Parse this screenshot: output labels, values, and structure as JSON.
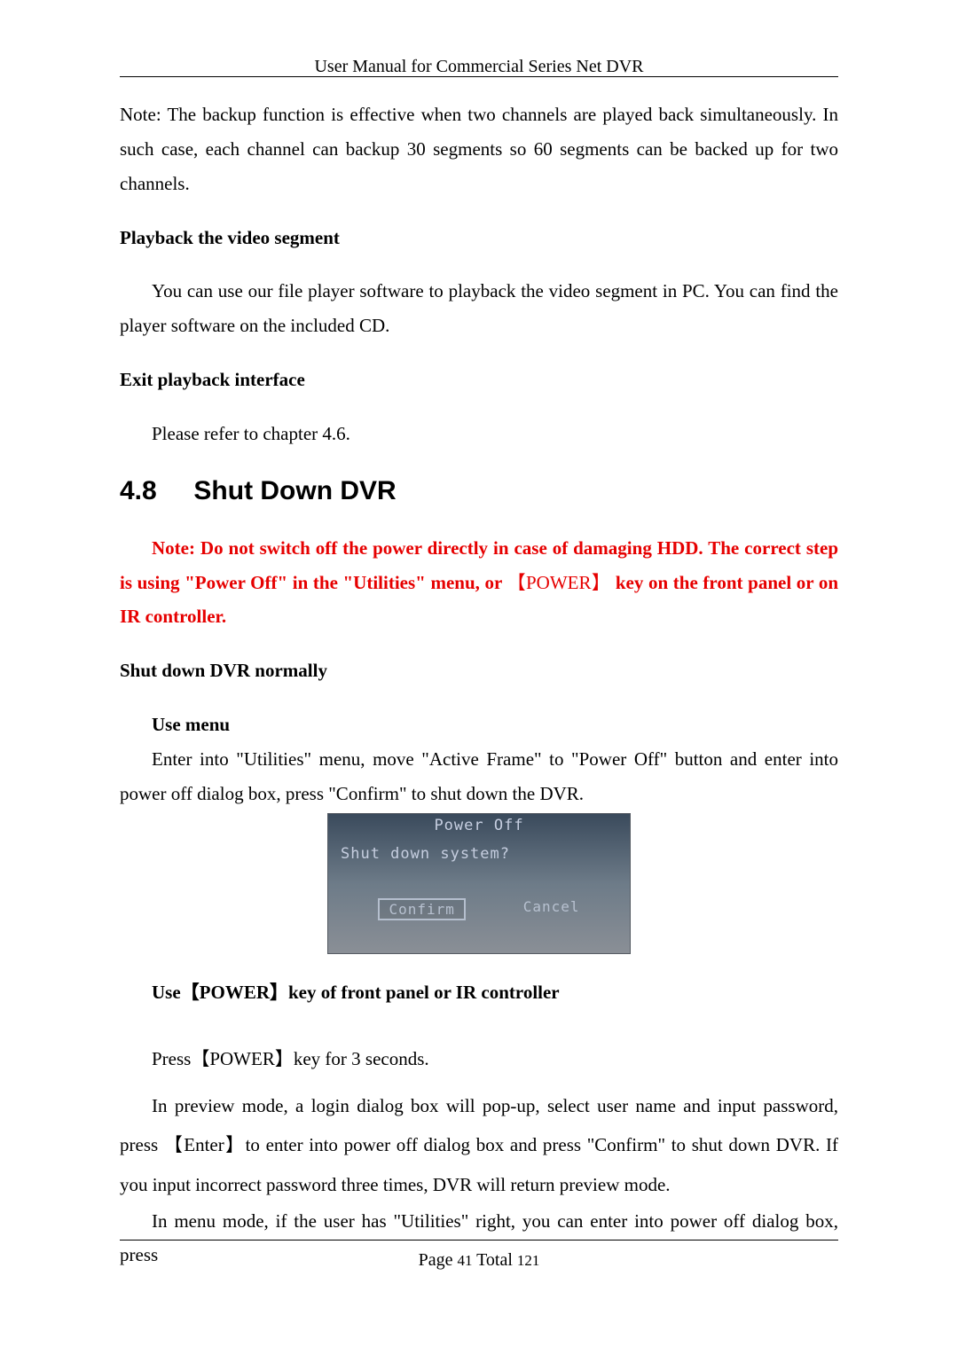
{
  "header": {
    "title": "User Manual for Commercial Series Net DVR"
  },
  "body": {
    "note_backup": "Note: The backup function is effective when two channels are played back simultaneously. In such case, each channel can backup 30 segments so 60 segments can be backed up for two channels.",
    "h_playback": "Playback the video segment",
    "p_playback": "You can use our file player software to playback the video segment in PC. You can find the player software on the included CD.",
    "h_exit": "Exit playback interface",
    "p_exit": "Please refer to chapter 4.6.",
    "section_num": "4.8",
    "section_title": "Shut Down DVR",
    "warn_part1": "Note: Do not switch off the power directly in case of damaging HDD. The correct step is using \"Power Off\" in the \"Utilities\" menu, or",
    "warn_key": "【POWER】",
    "warn_part2": "key on the front panel or on IR controller.",
    "h_normal": "Shut down DVR normally",
    "h_usemenu": "Use menu",
    "p_usemenu": "Enter into \"Utilities\" menu, move \"Active Frame\" to \"Power Off\" button and enter into power off dialog box, press \"Confirm\" to shut down the DVR.",
    "dialog": {
      "title": "Power Off",
      "message": "Shut down system?",
      "confirm": "Confirm",
      "cancel": "Cancel"
    },
    "h_usepower": "Use【POWER】key of front panel or IR controller",
    "p_press": "Press【POWER】key for 3 seconds.",
    "p_preview": "In preview mode, a login dialog box will pop-up, select user name and input password, press 【Enter】to enter into power off dialog box and press \"Confirm\" to shut down DVR. If you input incorrect password three times, DVR will return preview mode.",
    "p_menumode": "In menu mode, if the user has \"Utilities\" right, you can enter into power off dialog box, press"
  },
  "footer": {
    "page_label": "Page",
    "page_num": "41",
    "total_label": "Total",
    "total_num": "121"
  }
}
